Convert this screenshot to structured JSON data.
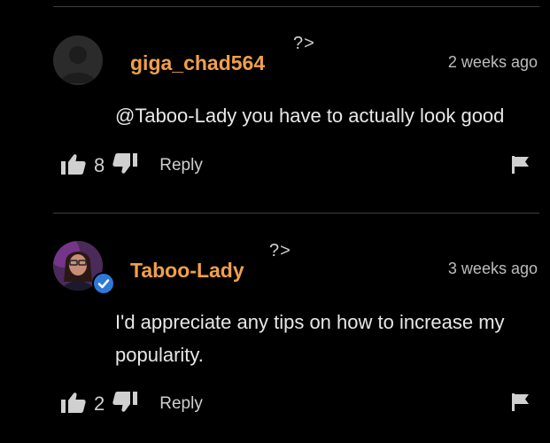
{
  "comments": [
    {
      "username": "giga_chad564",
      "qmark": "?>",
      "time": "2 weeks ago",
      "body": "@Taboo-Lady you have to actually look good",
      "likes": "8",
      "reply": "Reply"
    },
    {
      "username": "Taboo-Lady",
      "qmark": "?>",
      "time": "3 weeks ago",
      "body": "I'd appreciate any tips on how to increase my popularity.",
      "likes": "2",
      "reply": "Reply"
    }
  ],
  "colors": {
    "background": "#000000",
    "username": "#f0a04b",
    "verified_badge": "#2f78d8",
    "divider": "#3c3c3c"
  },
  "icons": [
    "thumbs-up-icon",
    "thumbs-down-icon",
    "flag-icon",
    "verified-icon",
    "default-avatar-icon"
  ]
}
